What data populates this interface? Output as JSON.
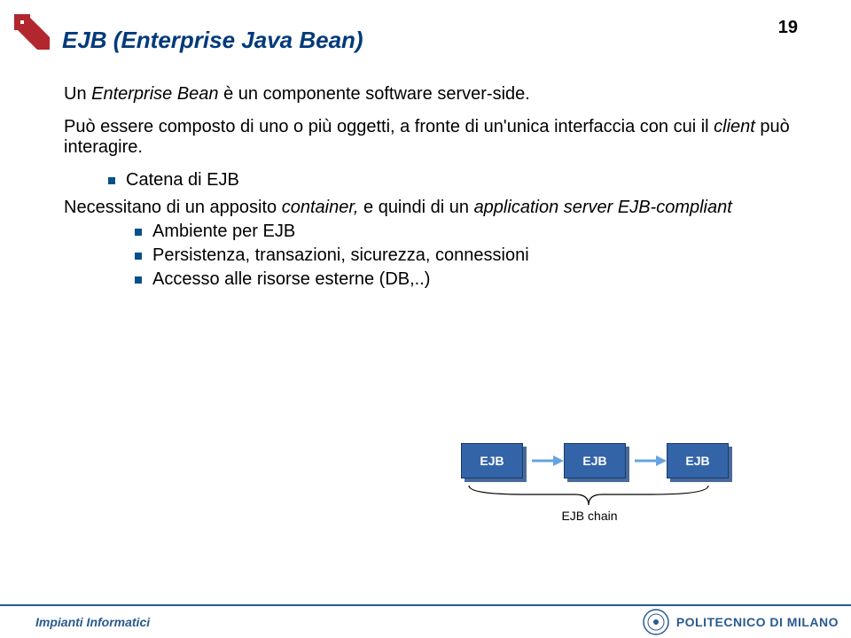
{
  "page_number": "19",
  "title": "EJB (Enterprise Java Bean)",
  "content": {
    "p1_prefix": "Un ",
    "p1_italic": "Enterprise Bean",
    "p1_suffix": " è un componente software server-side.",
    "p2_prefix": "Può essere composto di uno o più oggetti, a fronte di un'unica interfaccia con cui il ",
    "p2_italic": "client",
    "p2_suffix": " può interagire.",
    "b1": "Catena di EJB",
    "p3_prefix": "Necessitano di un apposito ",
    "p3_italic1": "container,",
    "p3_mid": " e quindi di un ",
    "p3_italic2": "application server EJB-compliant",
    "b2": "Ambiente per EJB",
    "b3": "Persistenza, transazioni, sicurezza, connessioni",
    "b4": "Accesso alle risorse esterne (DB,..)"
  },
  "diagram": {
    "box_label": "EJB",
    "chain_label": "EJB chain"
  },
  "footer": {
    "left": "Impianti Informatici",
    "right": "POLITECNICO DI MILANO"
  },
  "colors": {
    "brand_blue": "#003a7a",
    "accent_red": "#b1272d",
    "box_blue": "#3464a8"
  }
}
